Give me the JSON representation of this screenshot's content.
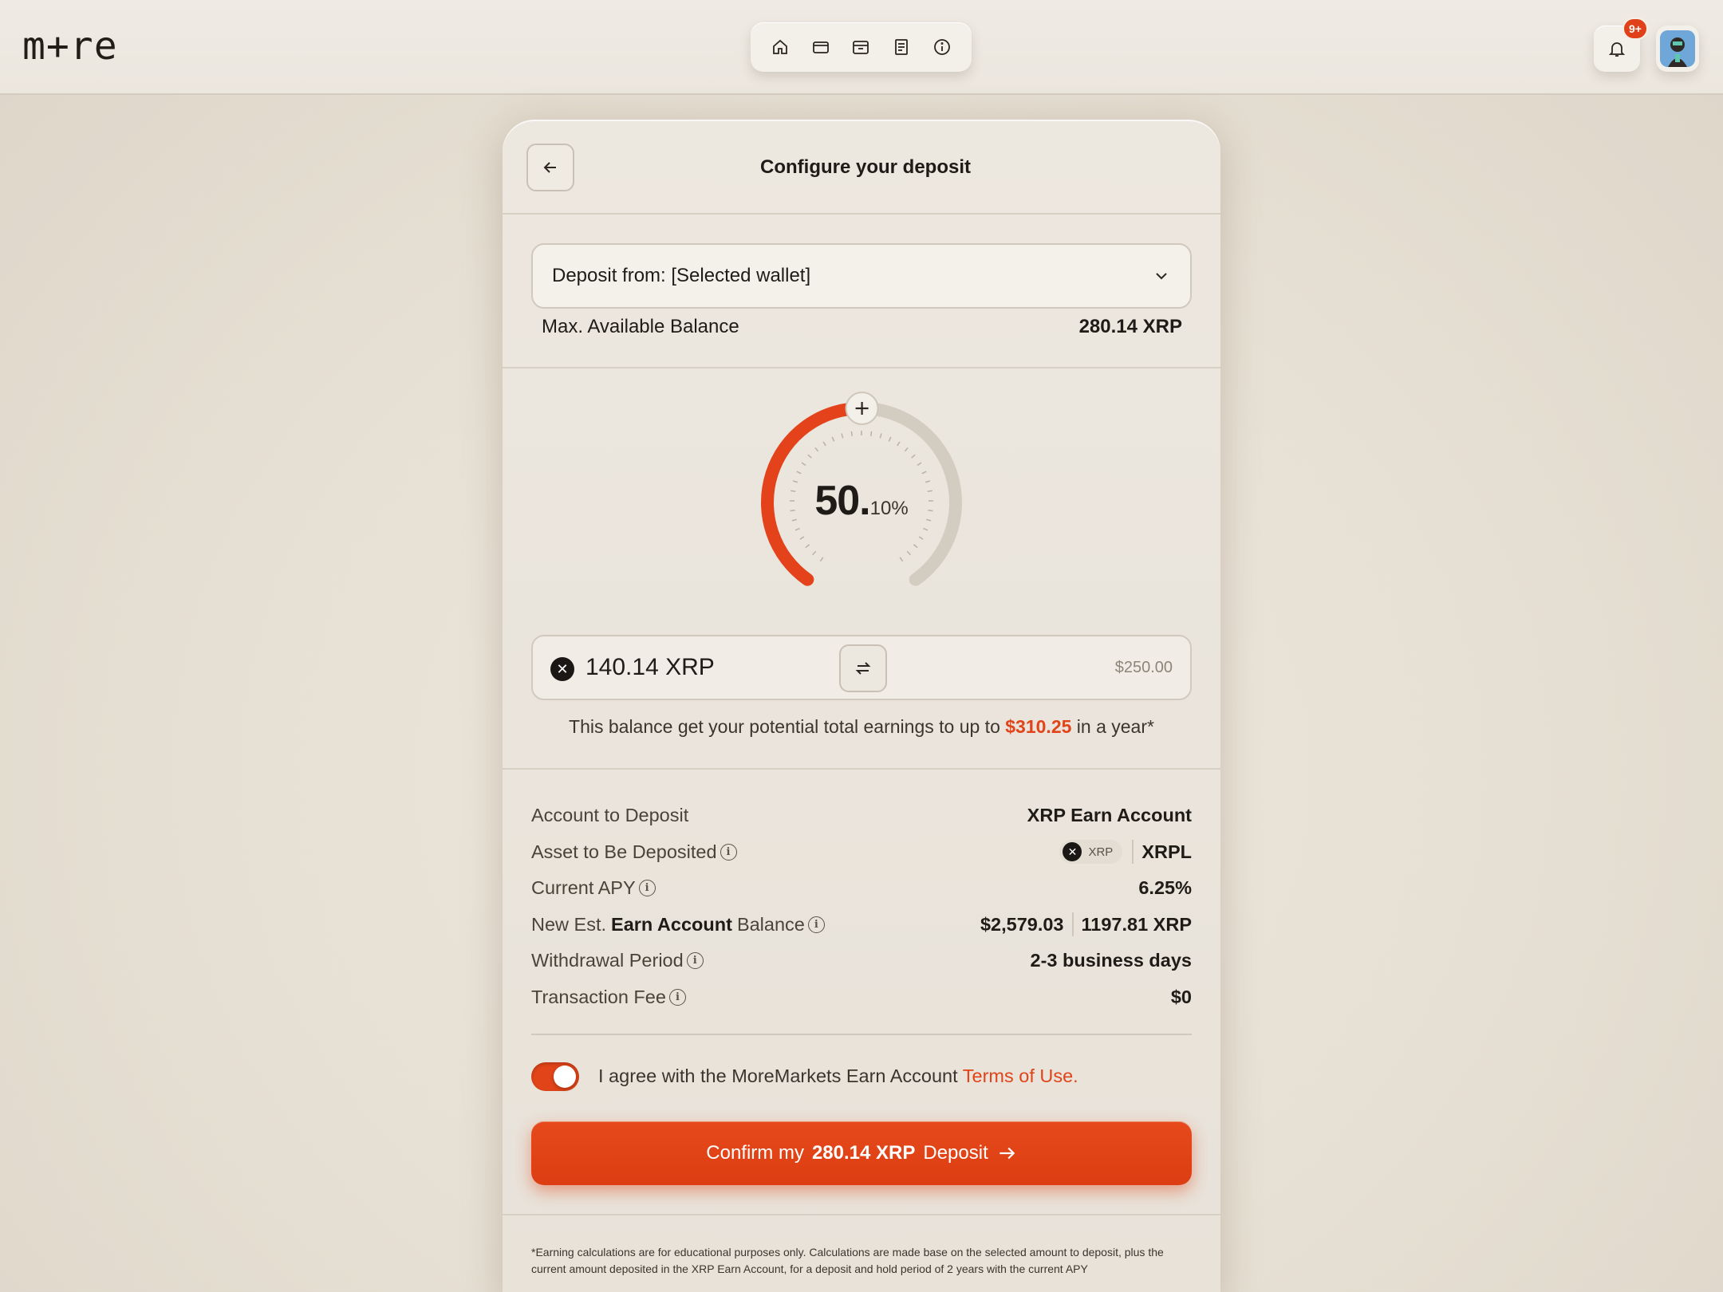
{
  "header": {
    "logo": "m+re",
    "nav": [
      "home-icon",
      "card-icon",
      "wallet-icon",
      "receipt-icon",
      "info-icon"
    ],
    "notifications_badge": "9+"
  },
  "card": {
    "title": "Configure your deposit",
    "deposit_from": "Deposit from: [Selected wallet]",
    "max_balance_label": "Max. Available Balance",
    "max_balance_value": "280.14 XRP",
    "dial": {
      "percent_major": "50.",
      "percent_minor": "10%",
      "fraction": 0.501
    },
    "amount": "140.14 XRP",
    "amount_usd": "$250.00",
    "earn_note_prefix": "This balance get your potential total earnings to up to",
    "earn_note_amount": "$310.25",
    "earn_note_suffix": "in a year*",
    "details": {
      "account_label": "Account to Deposit",
      "account_value": "XRP Earn Account",
      "asset_label": "Asset to Be Deposited",
      "asset_chip": "XRP",
      "asset_network": "XRPL",
      "apy_label": "Current APY",
      "apy_value": "6.25%",
      "new_balance_prefix": "New Est.",
      "new_balance_bold": "Earn Account",
      "new_balance_suffix": "Balance",
      "new_balance_usd": "$2,579.03",
      "new_balance_xrp": "1197.81 XRP",
      "withdrawal_label": "Withdrawal Period",
      "withdrawal_value": "2-3 business days",
      "fee_label": "Transaction Fee",
      "fee_value": "$0"
    },
    "agree_text": "I agree with the MoreMarkets Earn Account",
    "terms_link": "Terms of Use.",
    "confirm_prefix": "Confirm my",
    "confirm_amount": "280.14 XRP",
    "confirm_suffix": "Deposit",
    "footnote": "*Earning calculations are for educational purposes only. Calculations are made base on the selected amount to deposit, plus the current amount deposited in the XRP Earn Account, for a deposit and hold period of 2 years with the current APY"
  },
  "colors": {
    "accent": "#e04418",
    "background": "#e9e3da"
  }
}
